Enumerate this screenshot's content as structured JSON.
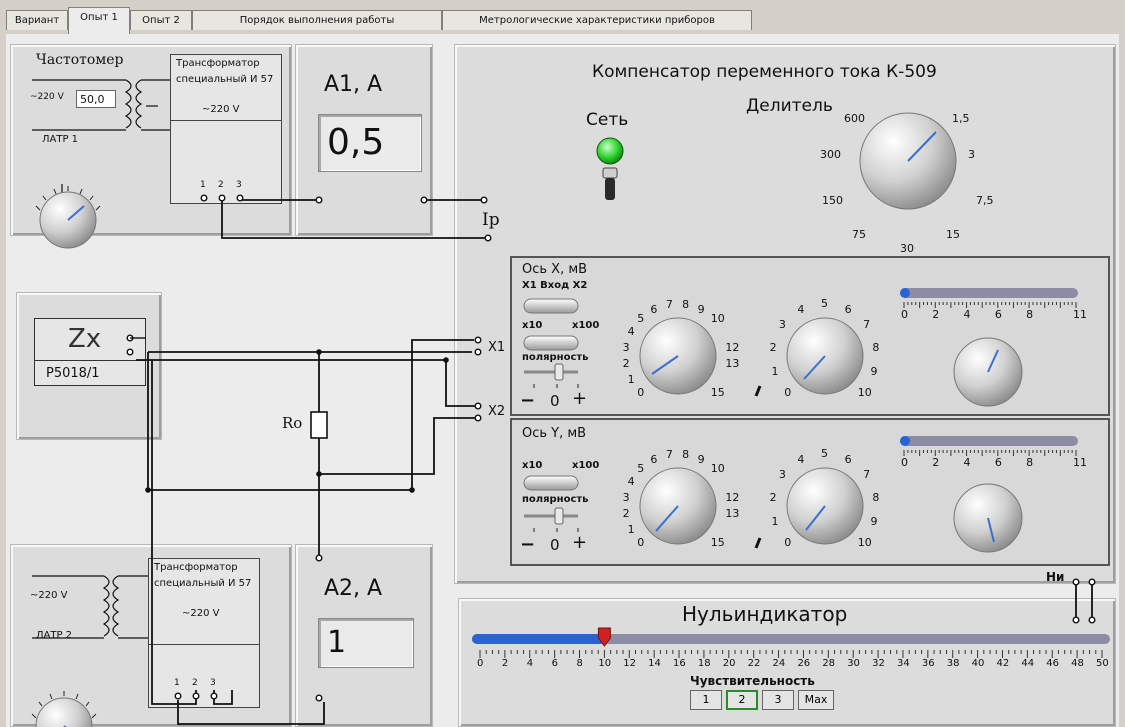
{
  "tabs": [
    {
      "label": "Вариант"
    },
    {
      "label": "Опыт 1"
    },
    {
      "label": "Опыт 2"
    },
    {
      "label": "Порядок выполнения работы"
    },
    {
      "label": "Метрологические характеристики приборов"
    }
  ],
  "active_tab": "Опыт 1",
  "freq_panel": {
    "title": "Частотомер",
    "value": "50,0",
    "voltage": "~220 V",
    "latr": "ЛАТР 1"
  },
  "transformer1": {
    "line1": "Трансформатор",
    "line2": "специальный И 57",
    "voltage": "~220 V",
    "terminals": [
      "1",
      "2",
      "3"
    ]
  },
  "transformer2": {
    "line1": "Трансформатор",
    "line2": "специальный И 57",
    "voltage": "~220 V",
    "terminals": [
      "1",
      "2",
      "3"
    ]
  },
  "latr2": {
    "voltage": "~220 V",
    "label": "ЛАТР 2"
  },
  "ammeter1": {
    "title": "A1, A",
    "value": "0,5"
  },
  "ammeter2": {
    "title": "A2, A",
    "value": "1"
  },
  "zx": {
    "symbol": "Zx",
    "model": "Р5018/1"
  },
  "circuit": {
    "ip": "Ip",
    "r0": "Ro",
    "x1": "X1",
    "x2": "X2",
    "ni": "Ни"
  },
  "compensator": {
    "title": "Компенсатор переменного тока К-509",
    "power": "Сеть",
    "divider": "Делитель",
    "divider_ticks": [
      "600",
      "1,5",
      "300",
      "3",
      "150",
      "7,5",
      "75",
      "30",
      "15"
    ]
  },
  "axis_x": {
    "title": "Ось X, мВ",
    "input": "X1 Вход X2",
    "mult1": "x10",
    "mult2": "x100",
    "polarity": "полярность",
    "pol_minus": "−",
    "pol_zero": "0",
    "pol_plus": "+"
  },
  "axis_y": {
    "title": "Ось Y, мВ",
    "mult1": "x10",
    "mult2": "x100",
    "polarity": "полярность",
    "pol_minus": "−",
    "pol_zero": "0",
    "pol_plus": "+"
  },
  "knob_big_ticks": [
    "0",
    "1",
    "2",
    "3",
    "4",
    "5",
    "6",
    "7",
    "8",
    "9",
    "10",
    "12",
    "13",
    "15"
  ],
  "knob_mid_ticks": [
    "0",
    "1",
    "2",
    "3",
    "4",
    "5",
    "6",
    "7",
    "8",
    "9",
    "10"
  ],
  "slider_ticks": [
    "0",
    "2",
    "4",
    "6",
    "8",
    "11"
  ],
  "null_indicator": {
    "title": "Нульиндикатор",
    "ticks": [
      "0",
      "2",
      "4",
      "6",
      "8",
      "10",
      "12",
      "14",
      "16",
      "18",
      "20",
      "22",
      "24",
      "26",
      "28",
      "30",
      "32",
      "34",
      "36",
      "38",
      "40",
      "42",
      "44",
      "46",
      "48",
      "50"
    ],
    "value": 10,
    "max": 50,
    "sensitivity": "Чувствительность",
    "buttons": [
      "1",
      "2",
      "3",
      "Max"
    ],
    "selected": "2"
  },
  "colors": {
    "needle": "#3a6fd0",
    "bar": "#2a63d6",
    "led": "#2ad02a",
    "marker": "#cc2222"
  }
}
